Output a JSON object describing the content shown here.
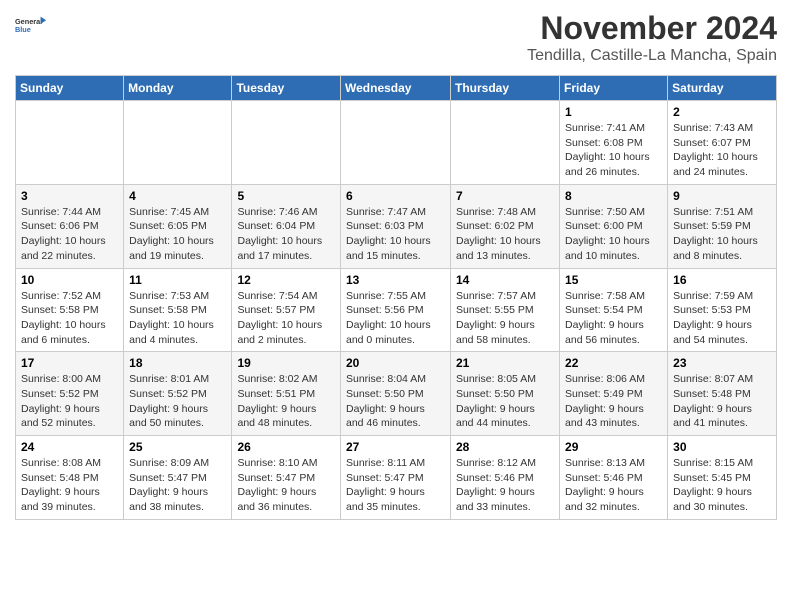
{
  "header": {
    "logo_line1": "General",
    "logo_line2": "Blue",
    "month_year": "November 2024",
    "location": "Tendilla, Castille-La Mancha, Spain"
  },
  "weekdays": [
    "Sunday",
    "Monday",
    "Tuesday",
    "Wednesday",
    "Thursday",
    "Friday",
    "Saturday"
  ],
  "weeks": [
    [
      {
        "day": "",
        "info": ""
      },
      {
        "day": "",
        "info": ""
      },
      {
        "day": "",
        "info": ""
      },
      {
        "day": "",
        "info": ""
      },
      {
        "day": "",
        "info": ""
      },
      {
        "day": "1",
        "info": "Sunrise: 7:41 AM\nSunset: 6:08 PM\nDaylight: 10 hours and 26 minutes."
      },
      {
        "day": "2",
        "info": "Sunrise: 7:43 AM\nSunset: 6:07 PM\nDaylight: 10 hours and 24 minutes."
      }
    ],
    [
      {
        "day": "3",
        "info": "Sunrise: 7:44 AM\nSunset: 6:06 PM\nDaylight: 10 hours and 22 minutes."
      },
      {
        "day": "4",
        "info": "Sunrise: 7:45 AM\nSunset: 6:05 PM\nDaylight: 10 hours and 19 minutes."
      },
      {
        "day": "5",
        "info": "Sunrise: 7:46 AM\nSunset: 6:04 PM\nDaylight: 10 hours and 17 minutes."
      },
      {
        "day": "6",
        "info": "Sunrise: 7:47 AM\nSunset: 6:03 PM\nDaylight: 10 hours and 15 minutes."
      },
      {
        "day": "7",
        "info": "Sunrise: 7:48 AM\nSunset: 6:02 PM\nDaylight: 10 hours and 13 minutes."
      },
      {
        "day": "8",
        "info": "Sunrise: 7:50 AM\nSunset: 6:00 PM\nDaylight: 10 hours and 10 minutes."
      },
      {
        "day": "9",
        "info": "Sunrise: 7:51 AM\nSunset: 5:59 PM\nDaylight: 10 hours and 8 minutes."
      }
    ],
    [
      {
        "day": "10",
        "info": "Sunrise: 7:52 AM\nSunset: 5:58 PM\nDaylight: 10 hours and 6 minutes."
      },
      {
        "day": "11",
        "info": "Sunrise: 7:53 AM\nSunset: 5:58 PM\nDaylight: 10 hours and 4 minutes."
      },
      {
        "day": "12",
        "info": "Sunrise: 7:54 AM\nSunset: 5:57 PM\nDaylight: 10 hours and 2 minutes."
      },
      {
        "day": "13",
        "info": "Sunrise: 7:55 AM\nSunset: 5:56 PM\nDaylight: 10 hours and 0 minutes."
      },
      {
        "day": "14",
        "info": "Sunrise: 7:57 AM\nSunset: 5:55 PM\nDaylight: 9 hours and 58 minutes."
      },
      {
        "day": "15",
        "info": "Sunrise: 7:58 AM\nSunset: 5:54 PM\nDaylight: 9 hours and 56 minutes."
      },
      {
        "day": "16",
        "info": "Sunrise: 7:59 AM\nSunset: 5:53 PM\nDaylight: 9 hours and 54 minutes."
      }
    ],
    [
      {
        "day": "17",
        "info": "Sunrise: 8:00 AM\nSunset: 5:52 PM\nDaylight: 9 hours and 52 minutes."
      },
      {
        "day": "18",
        "info": "Sunrise: 8:01 AM\nSunset: 5:52 PM\nDaylight: 9 hours and 50 minutes."
      },
      {
        "day": "19",
        "info": "Sunrise: 8:02 AM\nSunset: 5:51 PM\nDaylight: 9 hours and 48 minutes."
      },
      {
        "day": "20",
        "info": "Sunrise: 8:04 AM\nSunset: 5:50 PM\nDaylight: 9 hours and 46 minutes."
      },
      {
        "day": "21",
        "info": "Sunrise: 8:05 AM\nSunset: 5:50 PM\nDaylight: 9 hours and 44 minutes."
      },
      {
        "day": "22",
        "info": "Sunrise: 8:06 AM\nSunset: 5:49 PM\nDaylight: 9 hours and 43 minutes."
      },
      {
        "day": "23",
        "info": "Sunrise: 8:07 AM\nSunset: 5:48 PM\nDaylight: 9 hours and 41 minutes."
      }
    ],
    [
      {
        "day": "24",
        "info": "Sunrise: 8:08 AM\nSunset: 5:48 PM\nDaylight: 9 hours and 39 minutes."
      },
      {
        "day": "25",
        "info": "Sunrise: 8:09 AM\nSunset: 5:47 PM\nDaylight: 9 hours and 38 minutes."
      },
      {
        "day": "26",
        "info": "Sunrise: 8:10 AM\nSunset: 5:47 PM\nDaylight: 9 hours and 36 minutes."
      },
      {
        "day": "27",
        "info": "Sunrise: 8:11 AM\nSunset: 5:47 PM\nDaylight: 9 hours and 35 minutes."
      },
      {
        "day": "28",
        "info": "Sunrise: 8:12 AM\nSunset: 5:46 PM\nDaylight: 9 hours and 33 minutes."
      },
      {
        "day": "29",
        "info": "Sunrise: 8:13 AM\nSunset: 5:46 PM\nDaylight: 9 hours and 32 minutes."
      },
      {
        "day": "30",
        "info": "Sunrise: 8:15 AM\nSunset: 5:45 PM\nDaylight: 9 hours and 30 minutes."
      }
    ]
  ]
}
